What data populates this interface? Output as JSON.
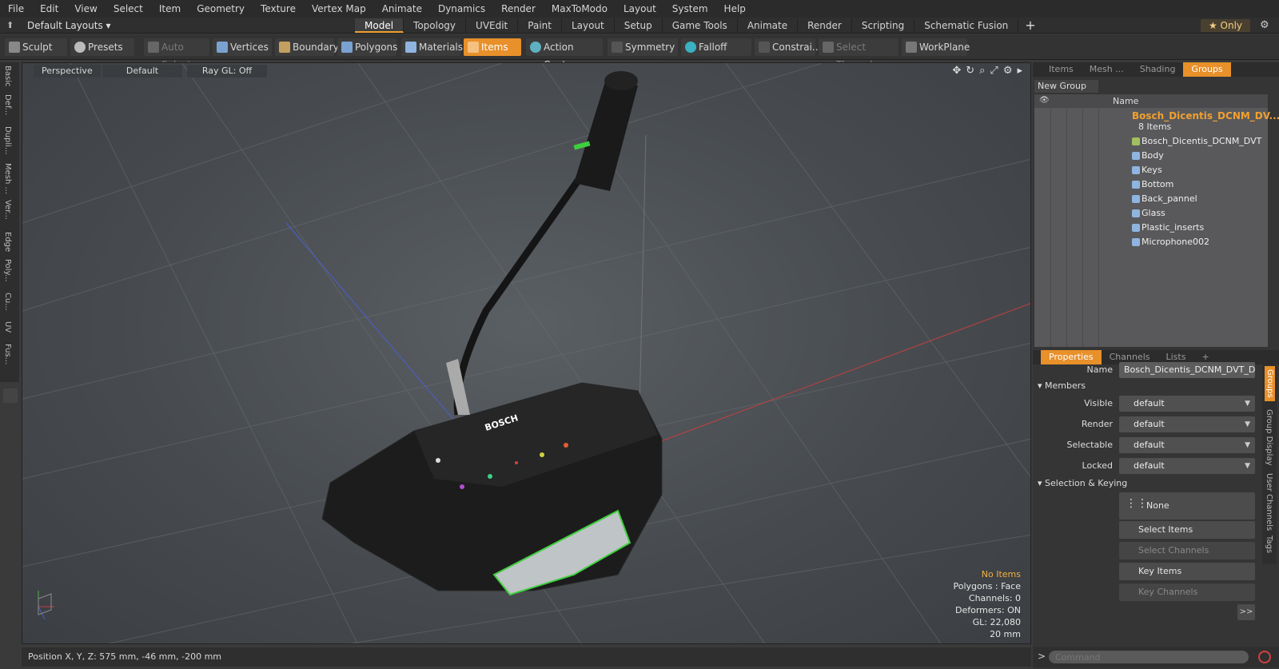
{
  "menu": [
    "File",
    "Edit",
    "View",
    "Select",
    "Item",
    "Geometry",
    "Texture",
    "Vertex Map",
    "Animate",
    "Dynamics",
    "Render",
    "MaxToModo",
    "Layout",
    "System",
    "Help"
  ],
  "layout": {
    "preset": "Default Layouts",
    "modes": [
      "Model",
      "Topology",
      "UVEdit",
      "Paint",
      "Layout",
      "Setup",
      "Game Tools",
      "Animate",
      "Render",
      "Scripting",
      "Schematic Fusion"
    ],
    "active_mode": "Model",
    "only_label": "Only"
  },
  "toolbar": {
    "sculpt": "Sculpt",
    "presets": "Presets",
    "auto_select": "Auto Select",
    "vertices": "Vertices",
    "boundary": "Boundary",
    "polygons": "Polygons",
    "materials": "Materials",
    "items": "Items",
    "action_center": "Action Center",
    "symmetry": "Symmetry",
    "falloff": "Falloff",
    "constraints": "Constrai...",
    "select_through": "Select Through",
    "workplane": "WorkPlane"
  },
  "left_tabs": [
    "Basic",
    "Def...",
    "Dupli...",
    "Mesh ...",
    "Ver...",
    "Edge",
    "Poly...",
    "Cu...",
    "UV",
    "Fus..."
  ],
  "viewport": {
    "view": "Perspective",
    "shading": "Default",
    "raygl": "Ray GL: Off",
    "stats": {
      "selection": "No Items",
      "polygons": "Polygons : Face",
      "channels": "Channels: 0",
      "deformers": "Deformers: ON",
      "gl": "GL: 22,080",
      "scale": "20 mm"
    },
    "brand": "BOSCH"
  },
  "status": {
    "position": "Position X, Y, Z:  575 mm, -46 mm, -200 mm"
  },
  "groups_panel": {
    "tabs": [
      "Items",
      "Mesh ...",
      "Shading",
      "Groups"
    ],
    "active_tab": "Groups",
    "new_group": "New Group",
    "column_name": "Name",
    "group_name": "Bosch_Dicentis_DCNM_DV...",
    "group_count": "8 Items",
    "members": [
      "Bosch_Dicentis_DCNM_DVT ...",
      "Body",
      "Keys",
      "Bottom",
      "Back_pannel",
      "Glass",
      "Plastic_inserts",
      "Microphone002"
    ]
  },
  "properties": {
    "tabs": [
      "Properties",
      "Channels",
      "Lists"
    ],
    "active_tab": "Properties",
    "name_label": "Name",
    "name_value": "Bosch_Dicentis_DCNM_DVT_Discu",
    "members_section": "Members",
    "visible_label": "Visible",
    "visible_value": "default",
    "render_label": "Render",
    "render_value": "default",
    "selectable_label": "Selectable",
    "selectable_value": "default",
    "locked_label": "Locked",
    "locked_value": "default",
    "selkey_section": "Selection & Keying",
    "none_label": "None",
    "select_items": "Select Items",
    "select_channels": "Select Channels",
    "key_items": "Key Items",
    "key_channels": "Key Channels",
    "more": ">>",
    "side_tabs": [
      "Groups",
      "Group Display",
      "User Channels",
      "Tags"
    ]
  },
  "command": {
    "placeholder": "Command"
  },
  "colors": {
    "accent": "#e8902a",
    "group_text": "#f0a030",
    "led_green": "#3ecf3e"
  }
}
